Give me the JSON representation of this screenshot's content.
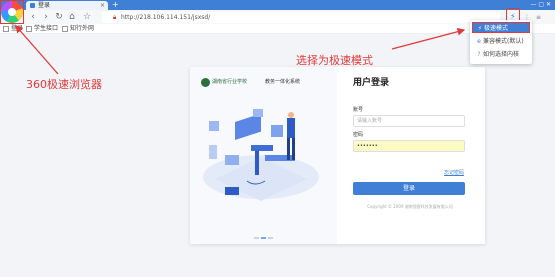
{
  "browser": {
    "tab_title": "登录",
    "tab_close": "×",
    "new_tab": "+",
    "window_controls": "— ▢ ✕",
    "url": "http://218.106.114.151/jsxsd/",
    "lock_icon": "lock-icon",
    "nav": {
      "back": "‹",
      "forward": "›",
      "reload": "↻",
      "home": "⌂",
      "favorite": "☆"
    },
    "mode_icon": "⚡",
    "right_icons": [
      "⚡",
      "⋮",
      "≡",
      "–"
    ]
  },
  "bookmarks": [
    {
      "label": "登录"
    },
    {
      "label": "学生接口"
    },
    {
      "label": "知行外网"
    }
  ],
  "mode_menu": {
    "items": [
      {
        "icon": "⚡",
        "label": "极速模式"
      },
      {
        "icon": "e",
        "label": "兼容模式(默认)"
      },
      {
        "icon": "?",
        "label": "如何选择内核"
      }
    ]
  },
  "annotations": {
    "left": "360极速浏览器",
    "right": "选择为极速模式"
  },
  "login": {
    "school_name": "湖南省行业学校",
    "system_name": "教务一体化系统",
    "title": "用户登录",
    "account_label": "账号",
    "account_placeholder": "请输入账号",
    "password_label": "密码",
    "password_value": "•••••••",
    "forgot": "忘记密码",
    "button": "登录",
    "copyright": "Copyright © 2009 湖南强智科技发展有限公司"
  },
  "colors": {
    "accent": "#3f7fd6",
    "annotation": "#e23a3a",
    "password_fill": "#fdfbc4"
  }
}
